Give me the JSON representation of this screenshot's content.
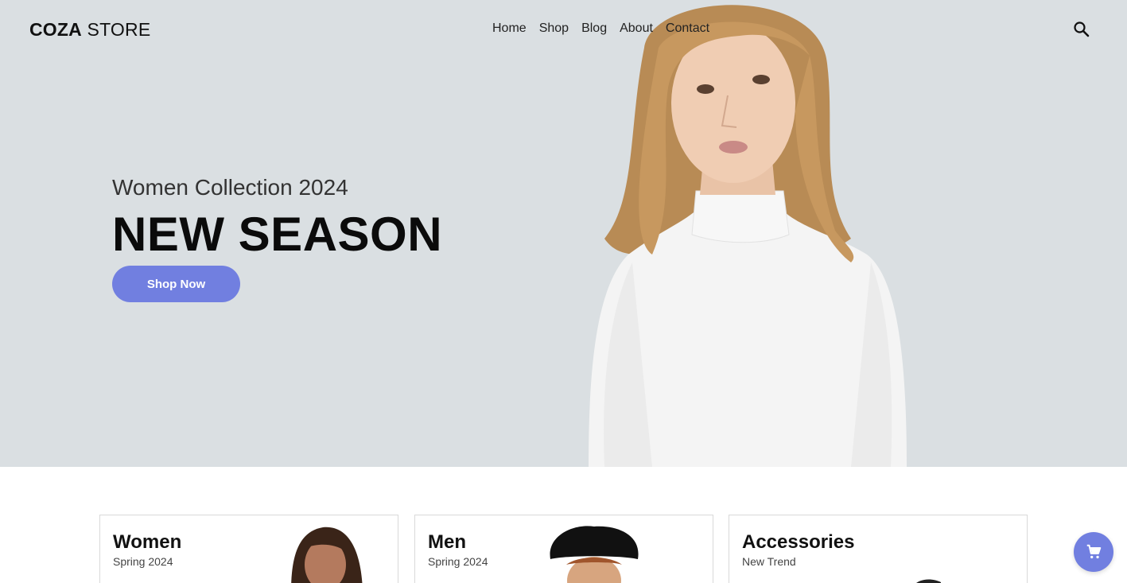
{
  "header": {
    "logo_bold": "COZA",
    "logo_light": " STORE",
    "nav": [
      "Home",
      "Shop",
      "Blog",
      "About",
      "Contact"
    ],
    "search_icon": "search-icon"
  },
  "hero": {
    "subtitle": "Women Collection 2024",
    "title": "NEW SEASON",
    "button_label": "Shop Now",
    "background_color": "#dadfe2",
    "accent_color": "#717fe0"
  },
  "banners": [
    {
      "title": "Women",
      "subtitle": "Spring 2024"
    },
    {
      "title": "Men",
      "subtitle": "Spring 2024"
    },
    {
      "title": "Accessories",
      "subtitle": "New Trend"
    }
  ],
  "cart_fab": {
    "icon": "cart-icon"
  }
}
